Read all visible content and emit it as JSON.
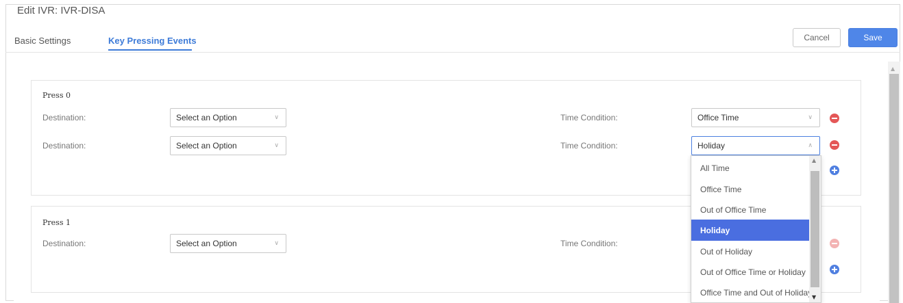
{
  "title": "Edit IVR: IVR-DISA",
  "tabs": {
    "basic": "Basic Settings",
    "key_pressing": "Key Pressing Events"
  },
  "buttons": {
    "cancel": "Cancel",
    "save": "Save"
  },
  "press0": {
    "title": "Press 0",
    "rows": [
      {
        "destination_label": "Destination:",
        "destination_value": "Select an Option",
        "time_label": "Time Condition:",
        "time_value": "Office Time"
      },
      {
        "destination_label": "Destination:",
        "destination_value": "Select an Option",
        "time_label": "Time Condition:",
        "time_value": "Holiday"
      }
    ]
  },
  "press1": {
    "title": "Press 1",
    "rows": [
      {
        "destination_label": "Destination:",
        "destination_value": "Select an Option",
        "time_label": "Time Condition:"
      }
    ]
  },
  "dropdown": {
    "options": [
      "All Time",
      "Office Time",
      "Out of Office Time",
      "Holiday",
      "Out of Holiday",
      "Out of Office Time or Holiday",
      "Office Time and Out of Holiday"
    ],
    "selected": "Holiday"
  },
  "colors": {
    "accent": "#4f86e8",
    "selected_bg": "#4a6ee0",
    "delete": "#e45757",
    "add": "#4f7fe0"
  },
  "icons": {
    "caret_down": "chevron-down-icon",
    "caret_up": "chevron-up-icon",
    "remove": "minus-circle-icon",
    "add": "plus-circle-icon"
  }
}
